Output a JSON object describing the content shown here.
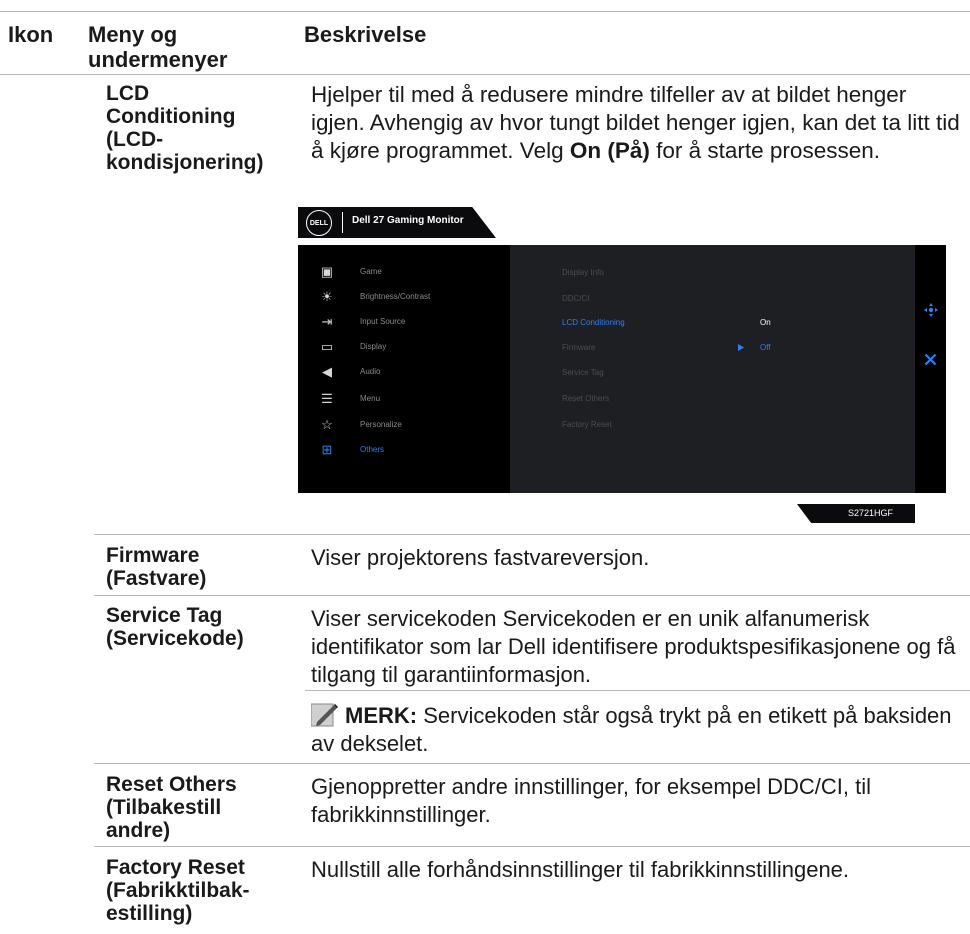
{
  "header": {
    "col_icon": "Ikon",
    "col_menu_line1": "Meny og",
    "col_menu_line2": "undermenyer",
    "col_desc": "Beskrivelse"
  },
  "rows": [
    {
      "name_lines": [
        "LCD",
        "Conditioning",
        "(LCD-",
        "kondisjonering)"
      ],
      "desc_pre": "Hjelper til med å redusere mindre tilfeller av at bildet henger igjen. Avhengig av hvor tungt bildet henger igjen, kan det ta litt tid å kjøre programmet. Velg ",
      "desc_bold": "On (På)",
      "desc_post": " for å starte prosessen."
    },
    {
      "name_lines": [
        "Firmware",
        "(Fastvare)"
      ],
      "desc": "Viser projektorens fastvareversjon."
    },
    {
      "name_lines": [
        "Service Tag",
        "(Servicekode)"
      ],
      "desc": "Viser servicekoden Servicekoden er en unik alfanumerisk identifikator som lar Dell identifisere produktspesifikasjonene og få tilgang til garantiinformasjon.",
      "note_label": "MERK:",
      "note_text": " Servicekoden står også trykt på en etikett på baksiden av dekselet."
    },
    {
      "name_lines": [
        "Reset Others",
        "(Tilbakestill",
        "andre)"
      ],
      "desc": "Gjenoppretter andre innstillinger, for eksempel DDC/CI, til fabrikkinnstillinger."
    },
    {
      "name_lines": [
        "Factory Reset",
        "(Fabrikktilbak-",
        "estilling)"
      ],
      "desc": "Nullstill alle forhåndsinnstillinger til fabrikkinnstillingene."
    }
  ],
  "osd": {
    "logo": "DELL",
    "title": "Dell 27 Gaming Monitor",
    "menu": [
      {
        "label": "Game",
        "icon": "gamepad-icon",
        "glyph": "▣"
      },
      {
        "label": "Brightness/Contrast",
        "icon": "brightness-icon",
        "glyph": "☀"
      },
      {
        "label": "Input Source",
        "icon": "input-source-icon",
        "glyph": "⇥"
      },
      {
        "label": "Display",
        "icon": "display-icon",
        "glyph": "▭"
      },
      {
        "label": "Audio",
        "icon": "audio-icon",
        "glyph": "◀"
      },
      {
        "label": "Menu",
        "icon": "menu-icon",
        "glyph": "☰"
      },
      {
        "label": "Personalize",
        "icon": "star-icon",
        "glyph": "☆"
      },
      {
        "label": "Others",
        "icon": "others-icon",
        "glyph": "⊞"
      }
    ],
    "active_menu": "Others",
    "submenu": [
      "Display Info",
      "DDC/CI",
      "LCD Conditioning",
      "Firmware",
      "Service Tag",
      "Reset Others",
      "Factory Reset"
    ],
    "active_submenu": "LCD Conditioning",
    "option_on": "On",
    "option_off": "Off",
    "model": "S2721HGF",
    "accent": "#2f7ff3"
  }
}
